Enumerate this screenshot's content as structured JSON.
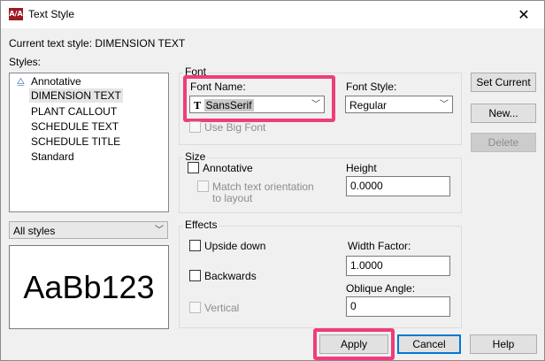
{
  "window": {
    "title": "Text Style",
    "app_icon": "A/A",
    "close_glyph": "✕"
  },
  "current_style": {
    "label": "Current text style:",
    "value": "DIMENSION TEXT"
  },
  "styles": {
    "label": "Styles:",
    "items": [
      {
        "label": "Annotative",
        "selected": false,
        "annotative_icon": true
      },
      {
        "label": "DIMENSION TEXT",
        "selected": true
      },
      {
        "label": "PLANT CALLOUT",
        "selected": false
      },
      {
        "label": "SCHEDULE TEXT",
        "selected": false
      },
      {
        "label": "SCHEDULE TITLE",
        "selected": false
      },
      {
        "label": "Standard",
        "selected": false
      }
    ],
    "filter": "All styles"
  },
  "preview": {
    "text": "AaBb123"
  },
  "font": {
    "group_title": "Font",
    "font_name_label": "Font Name:",
    "font_name_value": "SansSerif",
    "font_style_label": "Font Style:",
    "font_style_value": "Regular",
    "use_big_font_label": "Use Big Font"
  },
  "size": {
    "group_title": "Size",
    "annotative_label": "Annotative",
    "match_orientation_line1": "Match text orientation",
    "match_orientation_line2": "to layout",
    "height_label": "Height",
    "height_value": "0.0000"
  },
  "effects": {
    "group_title": "Effects",
    "upside_down_label": "Upside down",
    "backwards_label": "Backwards",
    "vertical_label": "Vertical",
    "width_factor_label": "Width Factor:",
    "width_factor_value": "1.0000",
    "oblique_angle_label": "Oblique Angle:",
    "oblique_angle_value": "0"
  },
  "buttons": {
    "set_current": "Set Current",
    "new": "New...",
    "delete": "Delete",
    "apply": "Apply",
    "cancel": "Cancel",
    "help": "Help"
  },
  "colors": {
    "highlight": "#ee3d7c",
    "accent": "#0078d7"
  }
}
